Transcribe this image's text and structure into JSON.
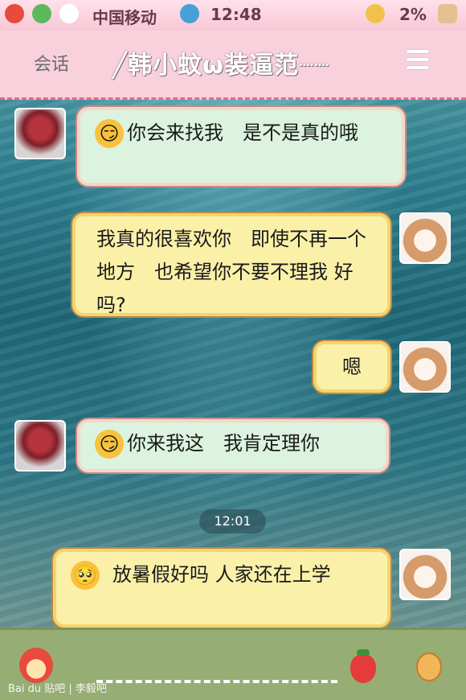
{
  "status_bar": {
    "carrier": "中国移动",
    "time": "12:48",
    "battery": "2%"
  },
  "header": {
    "back_label": "会话",
    "title": "╱韩小蚊ω装逼范┈┈",
    "menu_icon": "list-icon"
  },
  "messages": [
    {
      "side": "left",
      "emoji": "😏",
      "text": "你会来找我　是不是真的哦"
    },
    {
      "side": "right",
      "emoji": "",
      "text": "我真的很喜欢你　即使不再一个地方　也希望你不要不理我 好吗?"
    },
    {
      "side": "right",
      "emoji": "",
      "text": "嗯"
    },
    {
      "side": "left",
      "emoji": "😏",
      "text": "你来我这　我肯定理你"
    },
    {
      "side": "right",
      "emoji": "🥺",
      "text": "放暑假好吗 人家还在上学"
    }
  ],
  "timestamp": "12:01",
  "bottom_bar": {
    "watermark": "Bai du 贴吧 | 李毅吧"
  }
}
